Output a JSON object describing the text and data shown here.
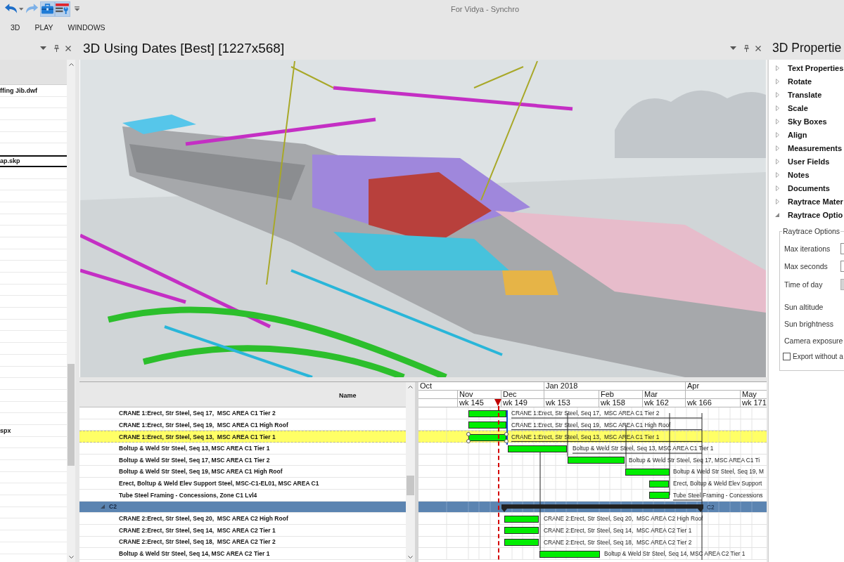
{
  "window": {
    "title": "For Vidya - Synchro"
  },
  "toolbar": [
    {
      "kind": "undo",
      "selected": false
    },
    {
      "kind": "redo",
      "selected": false
    },
    {
      "kind": "toolbox",
      "selected": true
    },
    {
      "kind": "panel-tools",
      "selected": true
    }
  ],
  "menu": [
    "3D",
    "PLAY",
    "WINDOWS"
  ],
  "left_panel": {
    "items": [
      {
        "label": "ffing Jib.dwf",
        "selected": false
      },
      {
        "label": "ap.skp",
        "selected": true
      },
      {
        "label": "spx",
        "selected": false
      }
    ]
  },
  "viewport": {
    "title": "3D Using Dates [Best] [1227x568]"
  },
  "gantt": {
    "column_header": "Name",
    "timeline": {
      "quarters": [
        "Oct",
        "Jan 2018",
        "Apr"
      ],
      "months": [
        "Nov",
        "Dec",
        "Feb",
        "Mar",
        "May"
      ],
      "weeks": [
        "wk 145",
        "wk 149",
        "wk 153",
        "wk 158",
        "wk 162",
        "wk 166",
        "wk 171"
      ]
    },
    "groups": [
      {
        "children": [
          {
            "name": "CRANE 1:Erect, Str Steel, Seq 17,  MSC AREA C1 Tier 2",
            "bar_label": "CRANE 1:Erect, Str Steel, Seq 17,  MSC AREA C1 Tier 2",
            "selected": false
          },
          {
            "name": "CRANE 1:Erect, Str Steel, Seq 19,  MSC AREA C1 High Roof",
            "bar_label": "CRANE 1:Erect, Str Steel, Seq 19,  MSC AREA C1 High Roof",
            "selected": false
          },
          {
            "name": "CRANE 1:Erect, Str Steel, Seq 13,  MSC AREA C1 Tier 1",
            "bar_label": "CRANE 1:Erect, Str Steel, Seq 13,  MSC AREA C1 Tier 1",
            "selected": true
          },
          {
            "name": "Boltup & Weld Str Steel, Seq 13, MSC AREA C1 Tier 1",
            "bar_label": "Boltup & Weld Str Steel, Seq 13, MSC AREA C1 Tier 1",
            "selected": false
          },
          {
            "name": "Boltup & Weld Str Steel, Seq 17, MSC AREA C1 Tier 2",
            "bar_label": "Boltup & Weld Str Steel, Seq 17, MSC AREA C1 Ti",
            "selected": false
          },
          {
            "name": "Boltup & Weld Str Steel, Seq 19, MSC AREA C1 High Roof",
            "bar_label": "Boltup & Weld Str Steel, Seq 19, M",
            "selected": false
          },
          {
            "name": "Erect, Boltup & Weld Elev Support Steel, MSC-C1-EL01, MSC AREA C1",
            "bar_label": "Erect, Boltup & Weld Elev Support",
            "selected": false
          },
          {
            "name": "Tube Steel Framing - Concessions, Zone C1 Lvl4",
            "bar_label": "Tube Steel Framing - Concessions",
            "selected": false
          }
        ]
      },
      {
        "name": "C2",
        "bar_label": "C2",
        "expanded": true,
        "selected": false,
        "children": [
          {
            "name": "CRANE 2:Erect, Str Steel, Seq 20,  MSC AREA C2 High Roof",
            "bar_label": "CRANE 2:Erect, Str Steel, Seq 20,  MSC AREA C2 High Roof",
            "selected": false
          },
          {
            "name": "CRANE 2:Erect, Str Steel, Seq 14,  MSC AREA C2 Tier 1",
            "bar_label": "CRANE 2:Erect, Str Steel, Seq 14,  MSC AREA C2 Tier 1",
            "selected": false
          },
          {
            "name": "CRANE 2:Erect, Str Steel, Seq 18,  MSC AREA C2 Tier 2",
            "bar_label": "CRANE 2:Erect, Str Steel, Seq 18,  MSC AREA C2 Tier 2",
            "selected": false
          },
          {
            "name": "Boltup & Weld Str Steel, Seq 14, MSC AREA C2 Tier 1",
            "bar_label": "Boltup & Weld Str Steel, Seq 14, MSC AREA C2 Tier 1",
            "selected": false
          }
        ]
      }
    ]
  },
  "properties_panel": {
    "title": "3D Propertie",
    "sections": [
      {
        "label": "Text Properties",
        "expanded": false
      },
      {
        "label": "Rotate",
        "expanded": false
      },
      {
        "label": "Translate",
        "expanded": false
      },
      {
        "label": "Scale",
        "expanded": false
      },
      {
        "label": "Sky Boxes",
        "expanded": false
      },
      {
        "label": "Align",
        "expanded": false
      },
      {
        "label": "Measurements",
        "expanded": false
      },
      {
        "label": "User Fields",
        "expanded": false
      },
      {
        "label": "Notes",
        "expanded": false
      },
      {
        "label": "Documents",
        "expanded": false
      },
      {
        "label": "Raytrace Mater",
        "expanded": false
      },
      {
        "label": "Raytrace Optio",
        "expanded": true,
        "options": {
          "legend": "Raytrace Options",
          "rows": [
            {
              "kind": "field",
              "label": "Max iterations",
              "disabled": false
            },
            {
              "kind": "field",
              "label": "Max seconds",
              "disabled": false
            },
            {
              "kind": "field",
              "label": "Time of day",
              "disabled": true
            },
            {
              "kind": "text",
              "label": "Sun altitude"
            },
            {
              "kind": "text",
              "label": "Sun brightness"
            },
            {
              "kind": "text",
              "label": "Camera exposure"
            }
          ],
          "checkbox": {
            "label": "Export without a",
            "checked": false
          }
        }
      }
    ]
  }
}
